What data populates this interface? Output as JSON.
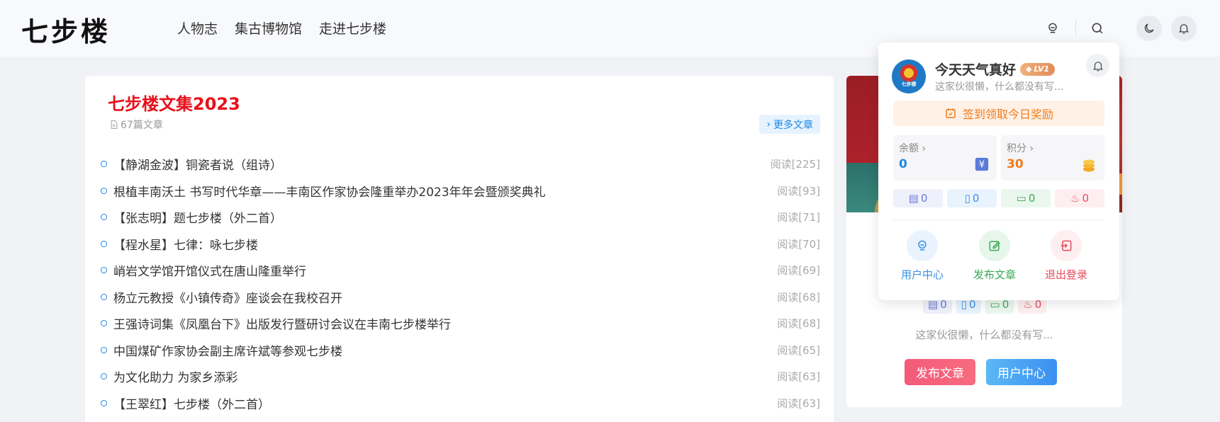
{
  "header": {
    "logo": "七步楼",
    "nav": [
      "人物志",
      "集古博物馆",
      "走进七步楼"
    ]
  },
  "main": {
    "title": "七步楼文集2023",
    "article_count": "67篇文章",
    "more_label": "更多文章",
    "articles": [
      {
        "title": "【静湖金波】铜瓷者说（组诗）",
        "reads": "阅读[225]"
      },
      {
        "title": "根植丰南沃土 书写时代华章——丰南区作家协会隆重举办2023年年会暨颁奖典礼",
        "reads": "阅读[93]"
      },
      {
        "title": "【张志明】题七步楼（外二首）",
        "reads": "阅读[71]"
      },
      {
        "title": "【程水星】七律：咏七步楼",
        "reads": "阅读[70]"
      },
      {
        "title": "峭岩文学馆开馆仪式在唐山隆重举行",
        "reads": "阅读[69]"
      },
      {
        "title": "杨立元教授《小镇传奇》座谈会在我校召开",
        "reads": "阅读[68]"
      },
      {
        "title": "王强诗词集《凤凰台下》出版发行暨研讨会议在丰南七步楼举行",
        "reads": "阅读[68]"
      },
      {
        "title": "中国煤矿作家协会副主席许斌等参观七步楼",
        "reads": "阅读[65]"
      },
      {
        "title": "为文化助力 为家乡添彩",
        "reads": "阅读[63]"
      },
      {
        "title": "【王翠红】七步楼（外二首）",
        "reads": "阅读[63]"
      }
    ]
  },
  "side": {
    "stats": [
      "0",
      "0",
      "0",
      "0"
    ],
    "desc": "这家伙很懒，什么都没有写...",
    "publish_label": "发布文章",
    "user_center_label": "用户中心"
  },
  "popup": {
    "avatar_text": "七步楼",
    "username": "今天天气真好",
    "level": "LV1",
    "desc": "这家伙很懒，什么都没有写...",
    "checkin_label": "签到领取今日奖励",
    "balance_label": "余额",
    "balance_value": "0",
    "points_label": "积分",
    "points_value": "30",
    "stats": [
      "0",
      "0",
      "0",
      "0"
    ],
    "actions": [
      "用户中心",
      "发布文章",
      "退出登录"
    ]
  },
  "colors": {
    "title_red": "#e8101b",
    "link_blue": "#1e88e5",
    "orange": "#f07a1a",
    "pink": "#e84a5a",
    "green": "#3aa957"
  }
}
